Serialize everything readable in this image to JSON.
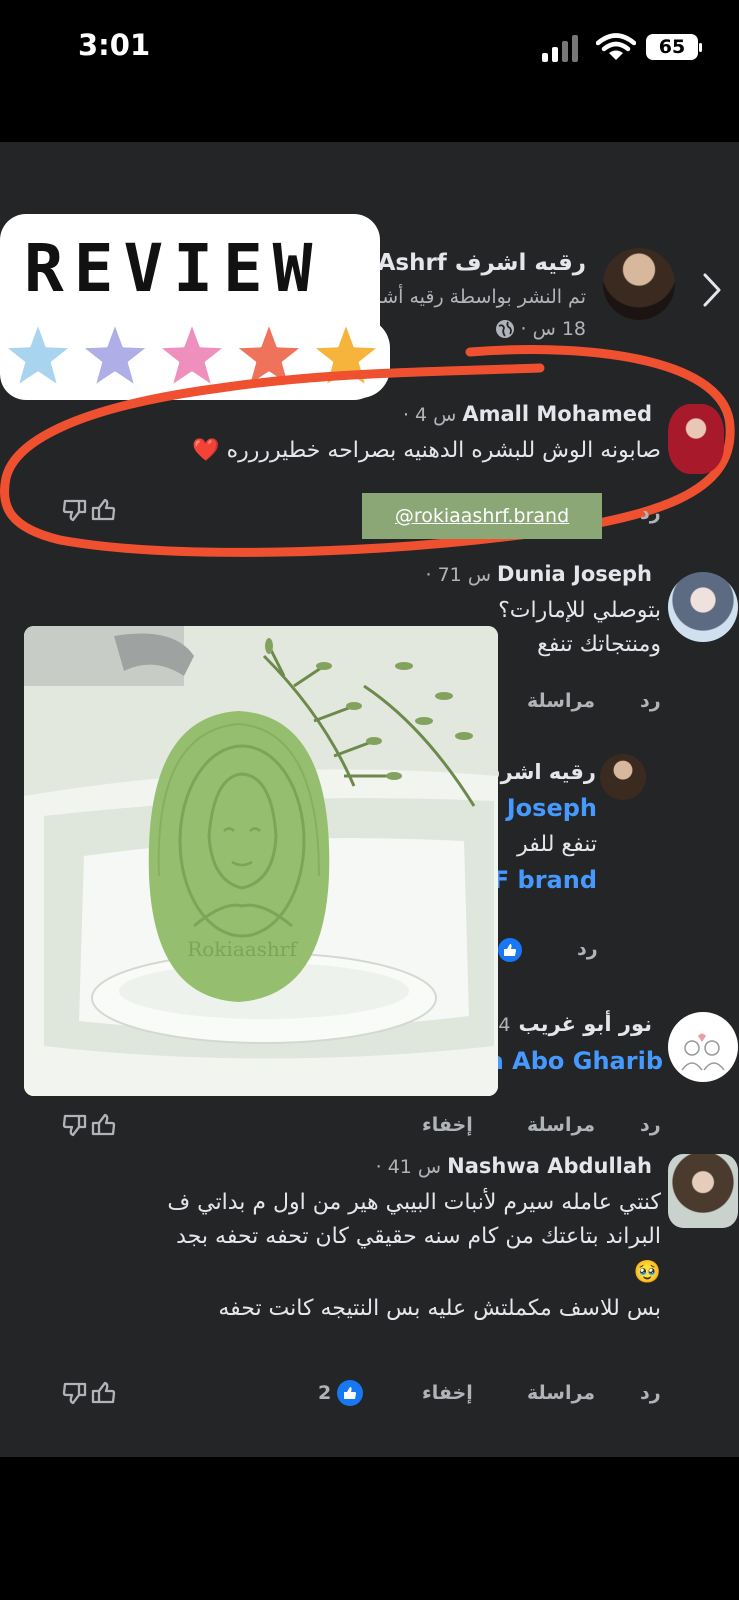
{
  "status_bar": {
    "time": "3:01",
    "battery": "65"
  },
  "sticker": {
    "text": "REVIEW",
    "star_colors": [
      "#a9d4ef",
      "#b0aee6",
      "#ef8fbd",
      "#ef735a",
      "#f7b43c"
    ]
  },
  "post": {
    "author": "رقيه اشرف Ashrf",
    "subtitle": "تم النشر بواسطة رقيه أشرف",
    "time": "18 س",
    "visibility_icon": "globe-icon"
  },
  "brand_handle": "@rokiaashrf.brand",
  "photo": {
    "soap_text": "Rokiaashrf"
  },
  "comments": [
    {
      "author": "Amall Mohamed",
      "time": "4 س",
      "text": "صابونه الوش للبشره الدهنيه بصراحه خطيرررره",
      "emoji": "❤️",
      "reply": "رد"
    },
    {
      "author": "Dunia Joseph",
      "time": "71 س",
      "lines": [
        "بتوصلي للإمارات؟",
        "ومنتجاتك تنفع"
      ],
      "reply": "رد",
      "message": "مراسلة"
    },
    {
      "author": "رقيه اشرف",
      "mention": "Joseph",
      "line": "تنفع للفر",
      "brand": "F brand",
      "reply": "رد"
    },
    {
      "author": "نور أبو غريب",
      "time": "4",
      "tag": "a Abo Gharib",
      "reply": "رد",
      "message": "مراسلة",
      "hide": "إخفاء"
    },
    {
      "author": "Nashwa Abdullah",
      "time": "41 س",
      "lines": [
        "كنتي عامله سيرم لأنبات البيبي هير من اول م بداتي ف",
        "البراند بتاعتك من كام سنه حقيقي كان تحفه تحفه بجد",
        "🥹",
        "بس للاسف مكملتش عليه بس النتيجه كانت تحفه"
      ],
      "reply": "رد",
      "message": "مراسلة",
      "hide": "إخفاء",
      "likes": "2"
    }
  ]
}
